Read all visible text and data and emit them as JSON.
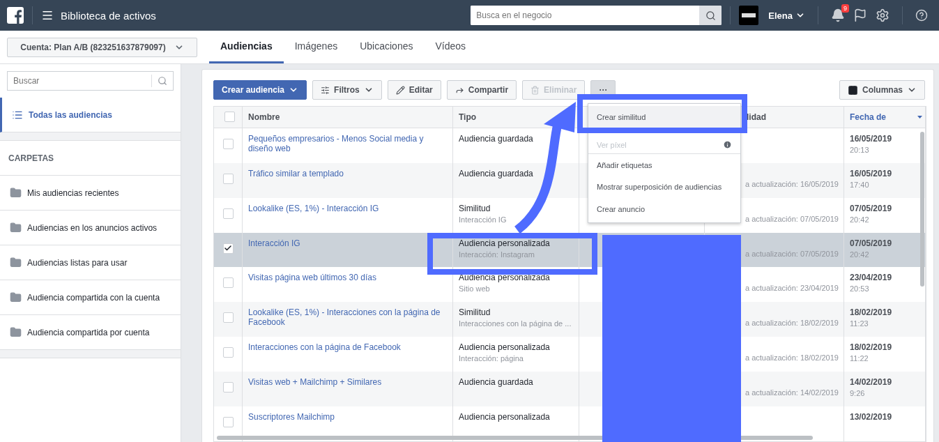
{
  "top_bar": {
    "title": "Biblioteca de activos",
    "search_placeholder": "Busca en el negocio",
    "user_name": "Elena",
    "notification_count": "9"
  },
  "account_selector": {
    "label": "Cuenta: Plan A/B (823251637879097)"
  },
  "tabs": [
    {
      "label": "Audiencias",
      "selected": true
    },
    {
      "label": "Imágenes",
      "selected": false
    },
    {
      "label": "Ubicaciones",
      "selected": false
    },
    {
      "label": "Vídeos",
      "selected": false
    }
  ],
  "sidebar": {
    "search_placeholder": "Buscar",
    "items": [
      {
        "label": "Todas las audiencias",
        "selected": true
      }
    ],
    "section_title": "CARPETAS",
    "folders": [
      {
        "label": "Mis audiencias recientes"
      },
      {
        "label": "Audiencias en los anuncios activos"
      },
      {
        "label": "Audiencias listas para usar"
      },
      {
        "label": "Audiencia compartida con la cuenta"
      },
      {
        "label": "Audiencia compartida por cuenta"
      }
    ]
  },
  "toolbar": {
    "buttons": [
      {
        "kind": "primary",
        "label": "Crear audiencia",
        "disabled": false
      },
      {
        "kind": "filter",
        "label": "Filtros",
        "disabled": false
      },
      {
        "kind": "edit",
        "label": "Editar",
        "disabled": false
      },
      {
        "kind": "share",
        "label": "Compartir",
        "disabled": false
      },
      {
        "kind": "delete",
        "label": "Eliminar",
        "disabled": true
      },
      {
        "kind": "more",
        "label": "···",
        "disabled": false
      }
    ],
    "columns_button": "Columnas"
  },
  "table": {
    "all_checked": false,
    "columns": [
      {
        "label": "Nombre",
        "sorted": false
      },
      {
        "label": "Tipo",
        "sorted": false
      },
      {
        "label": "lidad",
        "sorted": false
      },
      {
        "label": "Fecha de",
        "sorted": true
      }
    ],
    "rows": [
      {
        "selected": false,
        "name": "Pequeños empresarios - Menos Social media y diseño web",
        "type": "Audiencia guardada",
        "date": "16/05/2019",
        "time": "20:13"
      },
      {
        "selected": false,
        "name": "Tráfico similar a templado",
        "type": "Audiencia guardada",
        "update": "a actualización: 16/05/2019",
        "date": "16/05/2019",
        "time": "17:40"
      },
      {
        "selected": false,
        "name": "Lookalike (ES, 1%) - Interacción IG",
        "type": "Similitud",
        "subtype": "Interacción IG",
        "update": "a actualización: 07/05/2019",
        "date": "07/05/2019",
        "time": "20:42"
      },
      {
        "selected": true,
        "name": "Interacción IG",
        "type": "Audiencia personalizada",
        "subtype": "Interacción: Instagram",
        "update": "a actualización: 07/05/2019",
        "date": "07/05/2019",
        "time": "20:42"
      },
      {
        "selected": false,
        "name": "Visitas página web últimos 30 días",
        "type": "Audiencia personalizada",
        "subtype": "Sitio web",
        "update": "a actualización: 23/04/2019",
        "date": "23/04/2019",
        "time": "20:53"
      },
      {
        "selected": false,
        "name": "Lookalike (ES, 1%) - Interacciones con la página de Facebook",
        "type": "Similitud",
        "subtype": "Interacciones con la página de ...",
        "update": "a actualización: 18/02/2019",
        "date": "18/02/2019",
        "time": "11:23"
      },
      {
        "selected": false,
        "name": "Interacciones con la página de Facebook",
        "type": "Audiencia personalizada",
        "subtype": "Interacción: página",
        "update": "a actualización: 18/02/2019",
        "date": "18/02/2019",
        "time": "11:22"
      },
      {
        "selected": false,
        "name": "Visitas web + Mailchimp + Similares",
        "type": "Audiencia guardada",
        "update": "a actualización: 14/02/2019",
        "date": "14/02/2019",
        "time": "9:26"
      },
      {
        "selected": false,
        "name": "Suscriptores Mailchimp",
        "type": "Audiencia personalizada",
        "date": "13/02/2019"
      }
    ]
  },
  "menu": {
    "items": [
      {
        "label": "Crear similitud",
        "disabled": false,
        "highlighted": true,
        "info": false
      },
      {
        "label": "Ver píxel",
        "disabled": true,
        "highlighted": false,
        "info": true
      },
      {
        "label": "Añadir etiquetas",
        "disabled": false,
        "highlighted": false,
        "info": false,
        "divider_before": true
      },
      {
        "label": "Mostrar superposición de audiencias",
        "disabled": false,
        "highlighted": false,
        "info": false
      },
      {
        "label": "Crear anuncio",
        "disabled": false,
        "highlighted": false,
        "info": false
      }
    ]
  }
}
